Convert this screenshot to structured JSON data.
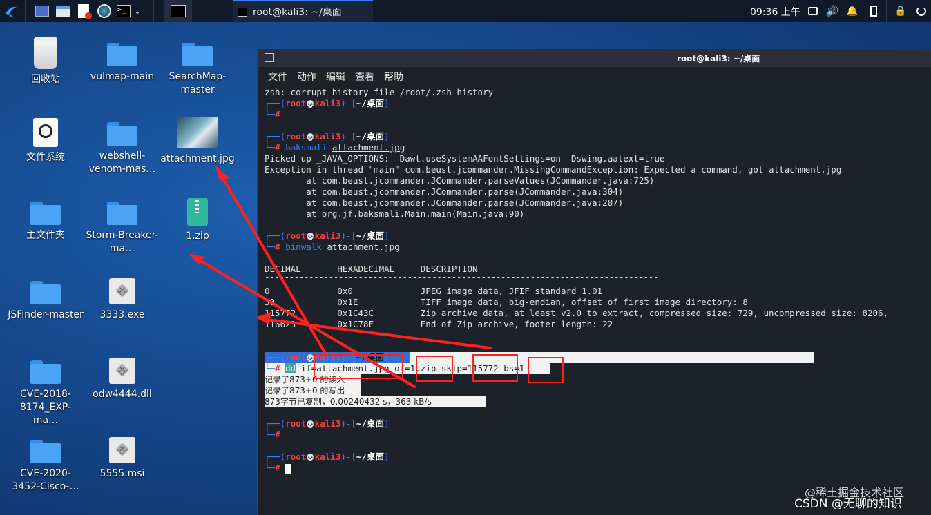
{
  "taskbar": {
    "window_title": "root@kali3: ~/桌面",
    "clock": "09:36 上午"
  },
  "desktop": {
    "items": [
      {
        "label": "回收站",
        "icon": "trash-icon"
      },
      {
        "label": "vulmap-main",
        "icon": "folder-icon"
      },
      {
        "label": "SearchMap-master",
        "icon": "folder-icon"
      },
      {
        "label": "文件系统",
        "icon": "drive-icon"
      },
      {
        "label": "webshell-venom-mas…",
        "icon": "folder-icon"
      },
      {
        "label": "attachment.jpg",
        "icon": "image-thumbnail"
      },
      {
        "label": "主文件夹",
        "icon": "home-folder-icon"
      },
      {
        "label": "Storm-Breaker-ma…",
        "icon": "folder-icon"
      },
      {
        "label": "1.zip",
        "icon": "zip-icon"
      },
      {
        "label": "JSFinder-master",
        "icon": "folder-icon"
      },
      {
        "label": "3333.exe",
        "icon": "exe-icon"
      },
      {
        "label": "CVE-2018-8174_EXP-ma…",
        "icon": "folder-icon"
      },
      {
        "label": "odw4444.dll",
        "icon": "dll-icon"
      },
      {
        "label": "CVE-2020-3452-Cisco-…",
        "icon": "folder-icon"
      },
      {
        "label": "5555.msi",
        "icon": "msi-icon"
      }
    ]
  },
  "terminal": {
    "title": "root@kali3: ~/桌面",
    "menu": [
      "文件",
      "动作",
      "编辑",
      "查看",
      "帮助"
    ],
    "prompt": {
      "user": "root",
      "host": "kali3",
      "path": "~/桌面",
      "skull": "💀",
      "hash": "#"
    },
    "zsh_error": "zsh: corrupt history file /root/.zsh_history",
    "cmd1": {
      "bin": "baksmali",
      "arg": "attachment.jpg"
    },
    "out1": [
      "Picked up _JAVA_OPTIONS: -Dawt.useSystemAAFontSettings=on -Dswing.aatext=true",
      "Exception in thread \"main\" com.beust.jcommander.MissingCommandException: Expected a command, got attachment.jpg",
      "        at com.beust.jcommander.JCommander.parseValues(JCommander.java:725)",
      "        at com.beust.jcommander.JCommander.parse(JCommander.java:304)",
      "        at com.beust.jcommander.JCommander.parse(JCommander.java:287)",
      "        at org.jf.baksmali.Main.main(Main.java:90)"
    ],
    "cmd2": {
      "bin": "binwalk",
      "arg": "attachment.jpg"
    },
    "binwalk_header": "DECIMAL       HEXADECIMAL     DESCRIPTION",
    "binwalk_rule": "--------------------------------------------------------------------------------",
    "binwalk_rows": [
      "0             0x0             JPEG image data, JFIF standard 1.01",
      "30            0x1E            TIFF image data, big-endian, offset of first image directory: 8",
      "115772        0x1C43C         Zip archive data, at least v2.0 to extract, compressed size: 729, uncompressed size: 8206,",
      "116623        0x1C78F         End of Zip archive, footer length: 22"
    ],
    "cmd3": {
      "bin": "dd",
      "args": "if=attachment.jpg of=1.zip skip=115772 bs=1"
    },
    "out3": [
      "记录了873+0 的读入",
      "记录了873+0 的写出",
      "873字节已复制，0.00240432 s，363 kB/s"
    ]
  },
  "watermark": {
    "line1": "@稀土掘金技术社区",
    "line2": "CSDN @无聊的知识"
  },
  "colors": {
    "prompt_frame": "#3a82ff",
    "prompt_user": "#ff3b3b",
    "annotation": "#ff2020"
  }
}
